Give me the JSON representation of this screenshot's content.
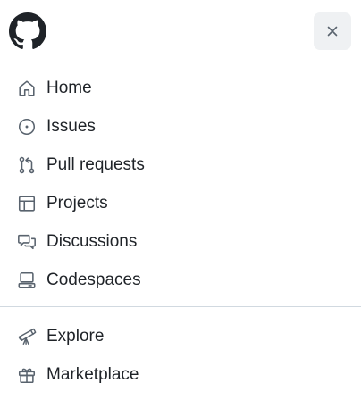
{
  "header": {
    "logo_icon": "github-mark-icon",
    "close_icon": "close-icon"
  },
  "primary_nav": [
    {
      "label": "Home",
      "icon": "home-icon"
    },
    {
      "label": "Issues",
      "icon": "issue-opened-icon"
    },
    {
      "label": "Pull requests",
      "icon": "git-pull-request-icon"
    },
    {
      "label": "Projects",
      "icon": "table-icon"
    },
    {
      "label": "Discussions",
      "icon": "comment-discussion-icon"
    },
    {
      "label": "Codespaces",
      "icon": "codespaces-icon"
    }
  ],
  "secondary_nav": [
    {
      "label": "Explore",
      "icon": "telescope-icon"
    },
    {
      "label": "Marketplace",
      "icon": "gift-icon"
    }
  ],
  "colors": {
    "text": "#1f2328",
    "icon": "#59636e",
    "close_button_bg": "#eff1f3",
    "divider": "#d1d9e0"
  }
}
